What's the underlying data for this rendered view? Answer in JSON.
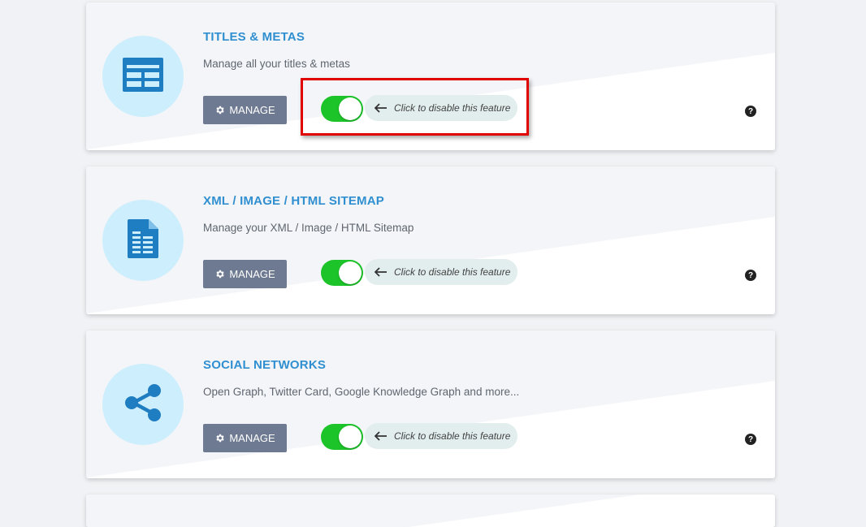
{
  "features": [
    {
      "title": "TITLES & METAS",
      "description": "Manage all your titles & metas",
      "icon": "table-icon",
      "manage_label": "MANAGE",
      "toggle_hint": "Click to disable this feature",
      "enabled": true
    },
    {
      "title": "XML / IMAGE / HTML SITEMAP",
      "description": "Manage your XML / Image / HTML Sitemap",
      "icon": "sitemap-document-icon",
      "manage_label": "MANAGE",
      "toggle_hint": "Click to disable this feature",
      "enabled": true
    },
    {
      "title": "SOCIAL NETWORKS",
      "description": "Open Graph, Twitter Card, Google Knowledge Graph and more...",
      "icon": "share-icon",
      "manage_label": "MANAGE",
      "toggle_hint": "Click to disable this feature",
      "enabled": true
    }
  ],
  "colors": {
    "title": "#2f8fd0",
    "icon": "#1f7dc1",
    "icon_circle": "#cdeefc",
    "toggle_on": "#1cc42a",
    "manage_button": "#6e7a92",
    "highlight": "#e00000"
  }
}
